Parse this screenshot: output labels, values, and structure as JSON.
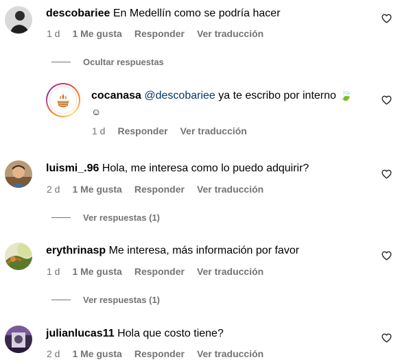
{
  "comments": [
    {
      "username": "descobariee",
      "text": "En Medellín como se podría hacer",
      "age": "1 d",
      "likes": "1 Me gusta",
      "reply": "Responder",
      "translate": "Ver traducción",
      "thread_toggle": "Ocultar respuestas",
      "replies": [
        {
          "username": "cocanasa",
          "mention": "@descobariee",
          "text": "ya te escribo por interno",
          "emoji_leaf": "🍃",
          "emoji_smile": "☺",
          "age": "1 d",
          "reply": "Responder",
          "translate": "Ver traducción"
        }
      ]
    },
    {
      "username": "luismi_.96",
      "text": "Hola, me interesa como lo puedo adquirir?",
      "age": "2 d",
      "likes": "1 Me gusta",
      "reply": "Responder",
      "translate": "Ver traducción",
      "thread_toggle": "Ver respuestas (1)"
    },
    {
      "username": "erythrinasp",
      "text": "Me interesa, más información por favor",
      "age": "1 d",
      "likes": "1 Me gusta",
      "reply": "Responder",
      "translate": "Ver traducción",
      "thread_toggle": "Ver respuestas (1)"
    },
    {
      "username": "julianlucas11",
      "text": "Hola que costo tiene?",
      "age": "2 d",
      "likes": "1 Me gusta",
      "reply": "Responder",
      "translate": "Ver traducción"
    }
  ],
  "icons": {
    "like": "heart-outline-icon"
  }
}
